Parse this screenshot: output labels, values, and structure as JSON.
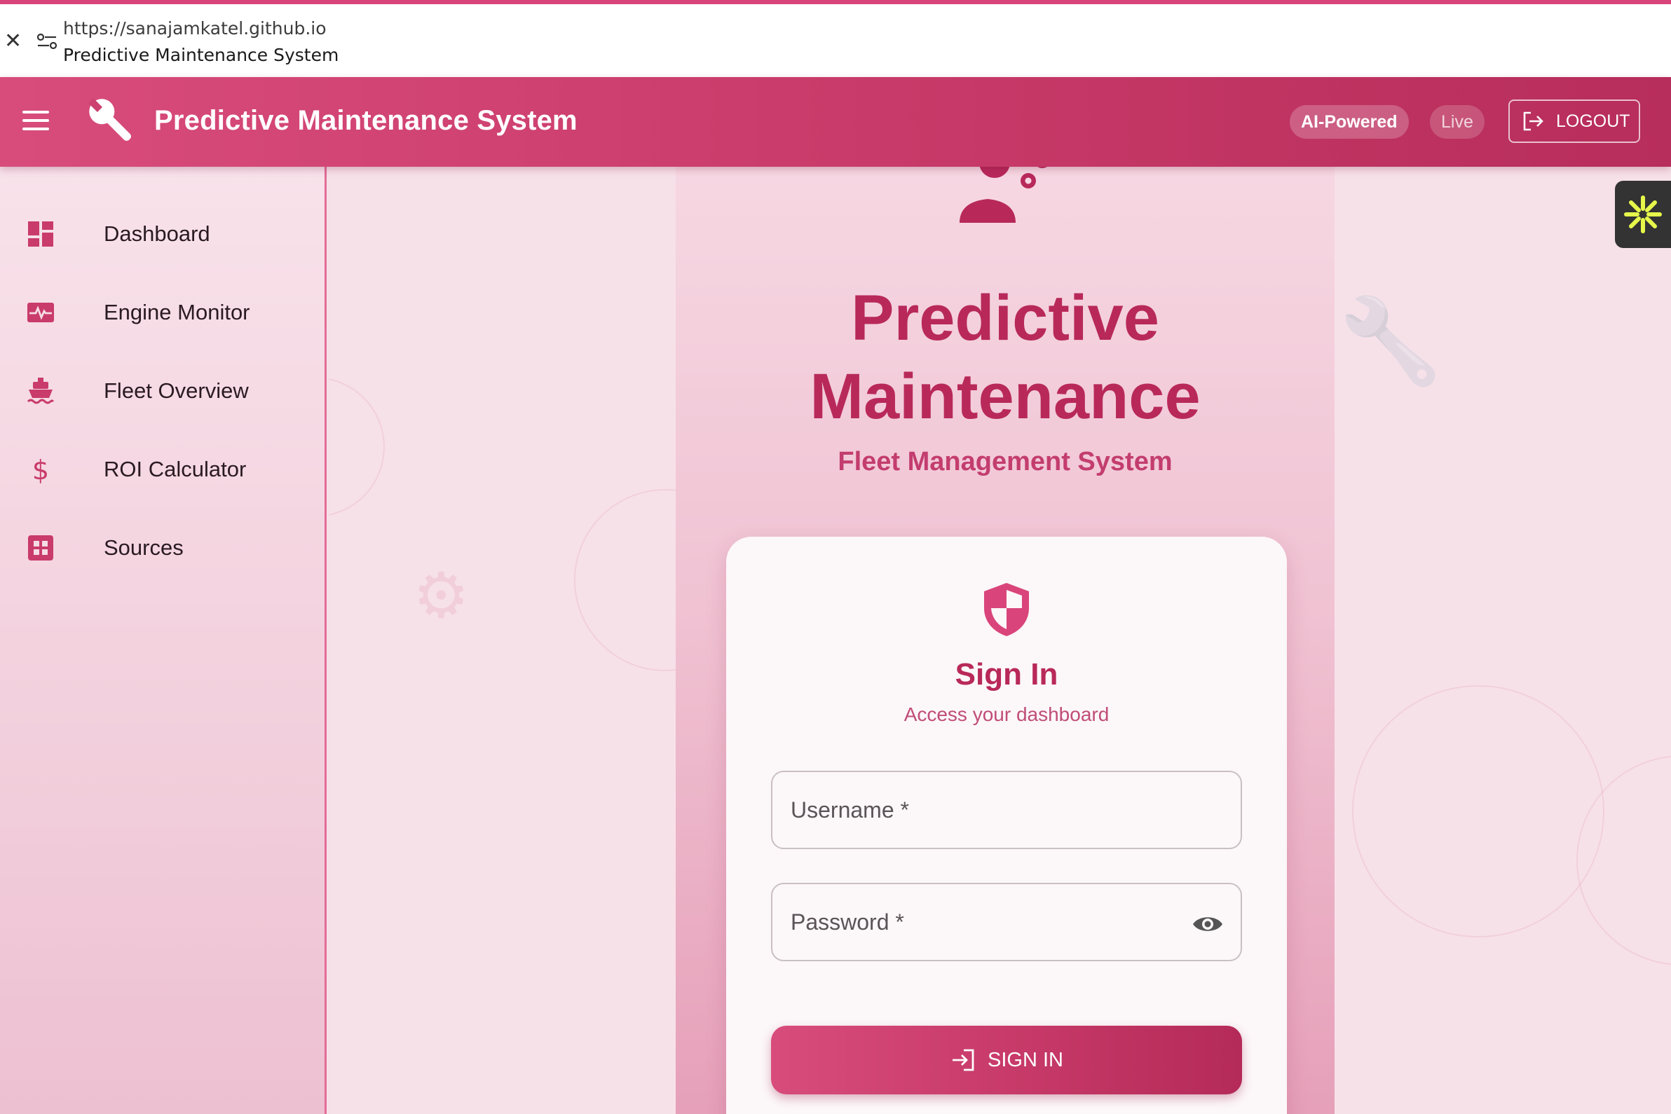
{
  "browser": {
    "url": "https://sanajamkatel.github.io",
    "tab_title": "Predictive Maintenance System"
  },
  "header": {
    "title": "Predictive Maintenance System",
    "chip_ai": "AI-Powered",
    "chip_live": "Live",
    "logout_label": "LOGOUT"
  },
  "sidebar": {
    "items": [
      {
        "label": "Dashboard",
        "icon": "dashboard-icon"
      },
      {
        "label": "Engine Monitor",
        "icon": "monitor-heart-icon"
      },
      {
        "label": "Fleet Overview",
        "icon": "ship-icon"
      },
      {
        "label": "ROI Calculator",
        "icon": "dollar-icon"
      },
      {
        "label": "Sources",
        "icon": "grid-icon"
      }
    ]
  },
  "hero": {
    "title_line1": "Predictive",
    "title_line2": "Maintenance",
    "subtitle": "Fleet Management System"
  },
  "login": {
    "title": "Sign In",
    "subtitle": "Access your dashboard",
    "username_placeholder": "Username *",
    "password_placeholder": "Password *",
    "signin_label": "SIGN IN"
  },
  "colors": {
    "primary": "#c93b6a",
    "accent": "#d9457a",
    "title": "#b8295a",
    "widget_star": "#e6f74a"
  }
}
